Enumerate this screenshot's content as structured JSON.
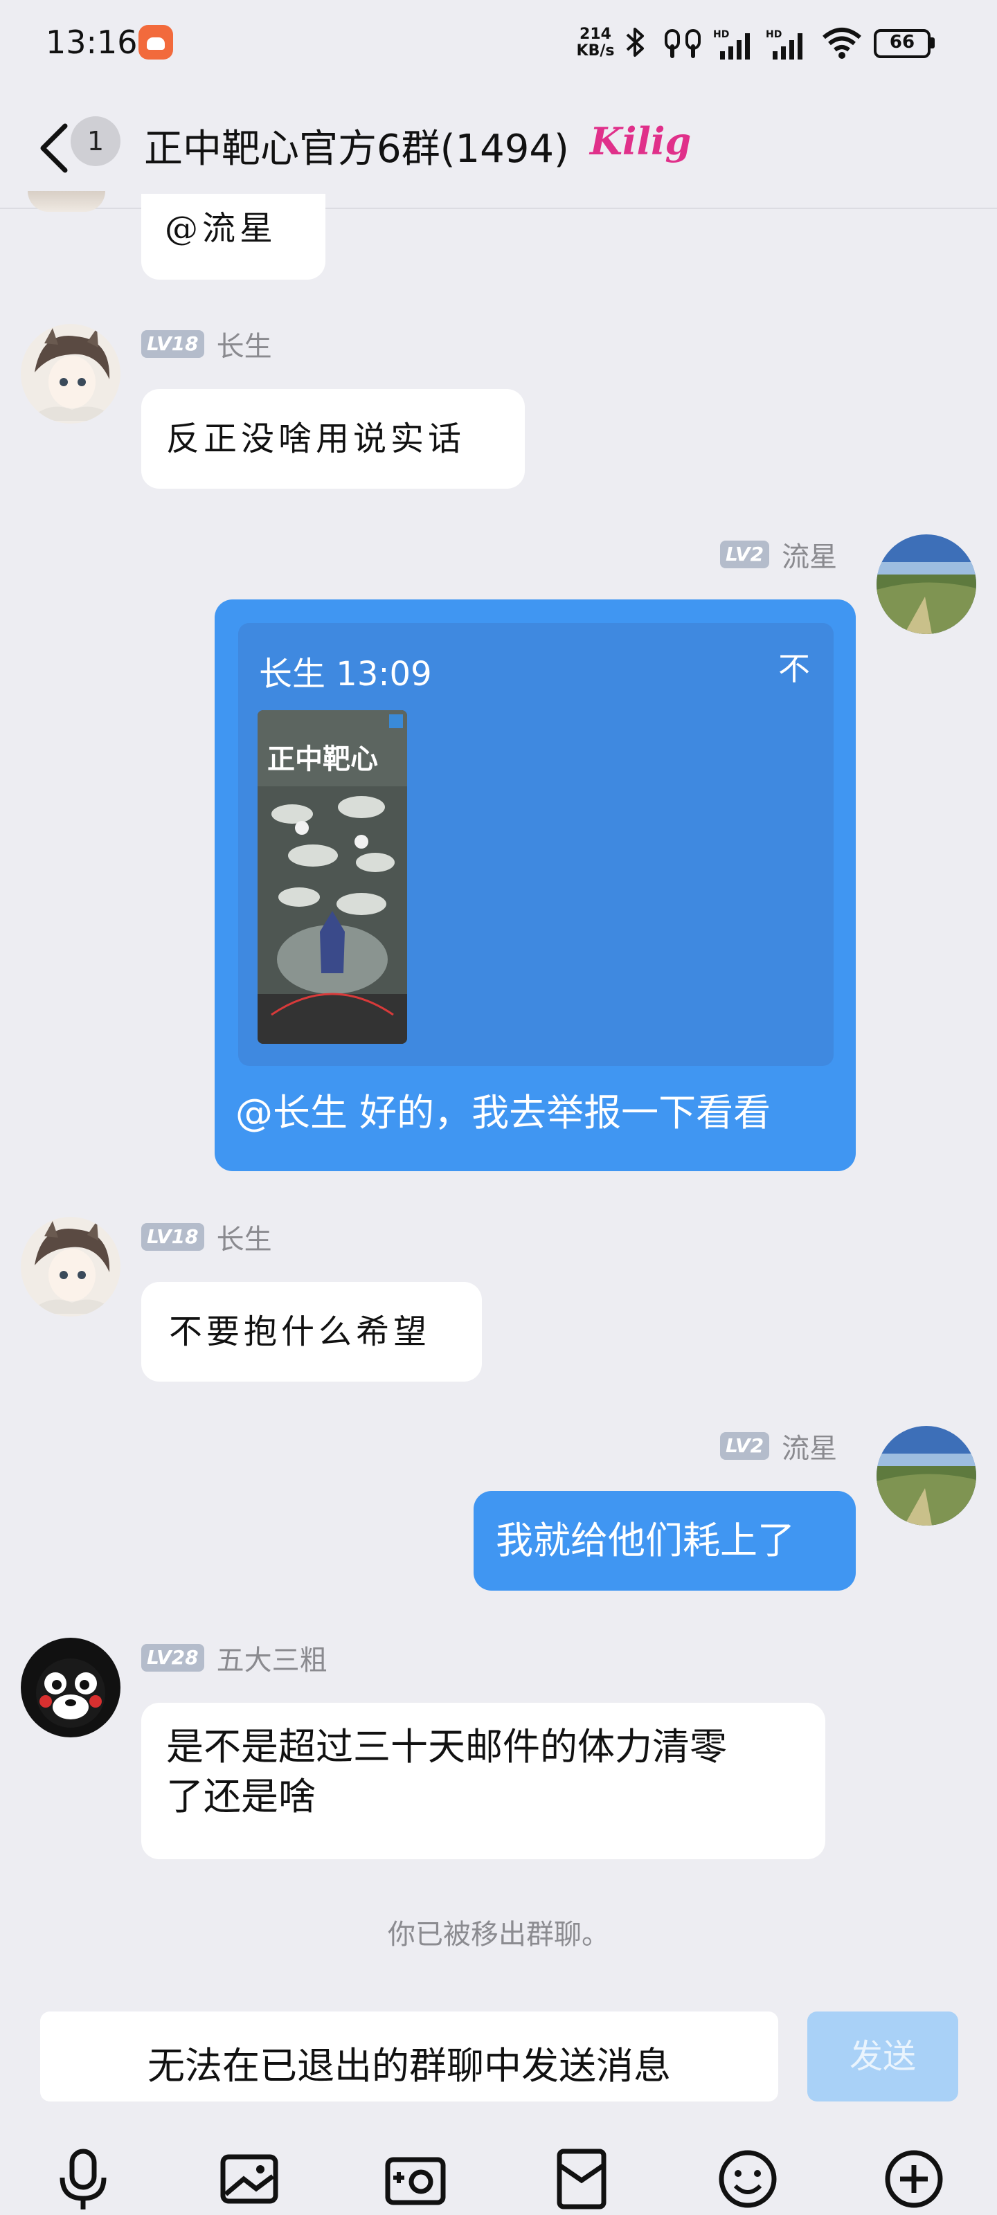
{
  "status_bar": {
    "time": "13:16",
    "speed_value": "214",
    "speed_unit": "KB/s",
    "battery": "66"
  },
  "header": {
    "unread_count": "1",
    "title": "正中靶心官方6群(1494)",
    "emblem": "Kilig"
  },
  "messages": [
    {
      "side": "left",
      "text": "@流星"
    },
    {
      "side": "left",
      "level": "LV18",
      "sender": "长生",
      "text": "反正没啥用说实话"
    },
    {
      "side": "right",
      "level": "LV2",
      "sender": "流星",
      "quote": {
        "author": "长生",
        "time": "13:09",
        "collapse_glyph": "不"
      },
      "text": "@长生 好的，我去举报一下看看"
    },
    {
      "side": "left",
      "level": "LV18",
      "sender": "长生",
      "text": "不要抱什么希望"
    },
    {
      "side": "right",
      "level": "LV2",
      "sender": "流星",
      "text": "我就给他们耗上了"
    },
    {
      "side": "left",
      "level": "LV28",
      "sender": "五大三粗",
      "text_line1": "是不是超过三十天邮件的体力清零",
      "text_line2": "了还是啥"
    }
  ],
  "quote_image": {
    "title": "正中靶心"
  },
  "system_notice": "你已被移出群聊。",
  "input": {
    "text": "无法在已退出的群聊中发送消息",
    "send_label": "发送"
  },
  "toolbar": {
    "items": [
      "microphone-icon",
      "image-icon",
      "camera-icon",
      "red-packet-icon",
      "emoji-icon",
      "plus-icon"
    ]
  },
  "colors": {
    "background": "#ededf2",
    "bubble_right": "#4096f2",
    "bubble_left": "#ffffff",
    "quote_card": "#3f89e0",
    "send_disabled": "#a9d1f7",
    "level_badge": "#b4bccb"
  }
}
